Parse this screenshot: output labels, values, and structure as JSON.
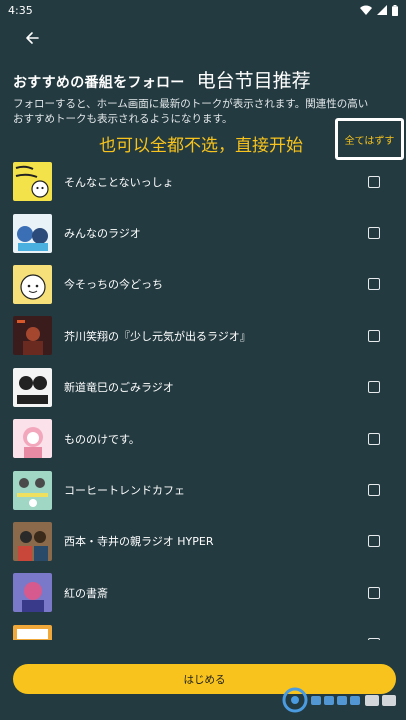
{
  "status_bar": {
    "time": "4:35"
  },
  "header": {
    "back_icon": "arrow-left-icon"
  },
  "title": "おすすめの番組をフォロー",
  "annotation_title": "电台节目推荐",
  "description": "フォローすると、ホーム画面に最新のトークが表示されます。関連性の高いおすすめトークも表示されるようになります。",
  "annotation_hint": "也可以全都不选，直接开始",
  "deselect_all_label": "全てはずす",
  "programs": [
    {
      "title": "そんなことないっしょ",
      "checked": false,
      "thumb_color": "#f3e24a"
    },
    {
      "title": "みんなのラジオ",
      "checked": false,
      "thumb_color": "#e9f2f6"
    },
    {
      "title": "今そっちの今どっち",
      "checked": false,
      "thumb_color": "#f6e07a"
    },
    {
      "title": "芥川笑翔の『少し元気が出るラジオ』",
      "checked": false,
      "thumb_color": "#3a1c1c"
    },
    {
      "title": "新道竜巳のごみラジオ",
      "checked": false,
      "thumb_color": "#f4f4f4"
    },
    {
      "title": "もののけです。",
      "checked": false,
      "thumb_color": "#fbe2ea"
    },
    {
      "title": "コーヒートレンドカフェ",
      "checked": false,
      "thumb_color": "#9fd6c4"
    },
    {
      "title": "西本・寺井の親ラジオ HYPER",
      "checked": false,
      "thumb_color": "#8a6a4a"
    },
    {
      "title": "紅の書斎",
      "checked": false,
      "thumb_color": "#7a78c8"
    },
    {
      "title": "",
      "checked": false,
      "thumb_color": "#f0a83a"
    }
  ],
  "start_button_label": "はじめる",
  "colors": {
    "background": "#233a40",
    "accent": "#f7c31c"
  }
}
